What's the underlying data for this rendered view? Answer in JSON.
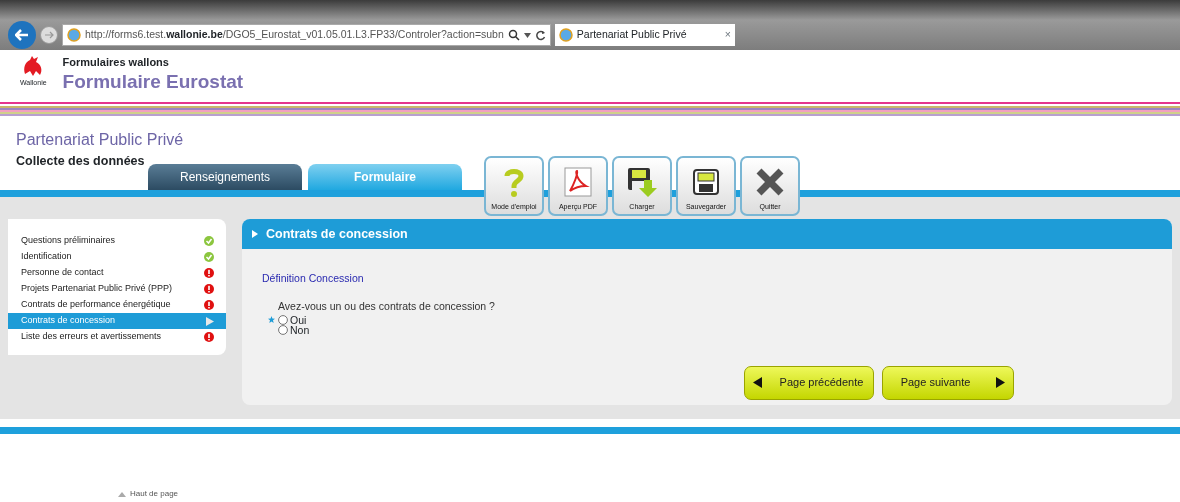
{
  "browser": {
    "url_prefix": "http://forms6.test.",
    "url_domain": "wallonie.be",
    "url_rest": "/DGO5_Eurostat_v01.05.01.L3.FP33/Controler?action=subn",
    "tab_title": "Partenariat Public Privé",
    "tab_close": "×"
  },
  "header": {
    "logo_caption": "Wallonie",
    "subtitle": "Formulaires wallons",
    "title": "Formulaire Eurostat"
  },
  "page": {
    "title": "Partenariat Public Privé",
    "subtitle": "Collecte des données"
  },
  "tabs": [
    {
      "label": "Renseignements",
      "selected": false
    },
    {
      "label": "Formulaire",
      "selected": true
    }
  ],
  "toolbar": [
    {
      "kind": "help",
      "label": "Mode d'emploi"
    },
    {
      "kind": "pdf",
      "label": "Aperçu PDF"
    },
    {
      "kind": "load",
      "label": "Charger"
    },
    {
      "kind": "save",
      "label": "Sauvegarder"
    },
    {
      "kind": "quit",
      "label": "Quitter"
    }
  ],
  "sidebar": {
    "items": [
      {
        "label": "Questions préliminaires",
        "kind": "ok",
        "selected": false
      },
      {
        "label": "Identification",
        "kind": "ok",
        "selected": false
      },
      {
        "label": "Personne de contact",
        "kind": "error",
        "selected": false
      },
      {
        "label": "Projets Partenariat Public Privé (PPP)",
        "kind": "error",
        "selected": false
      },
      {
        "label": "Contrats de performance énergétique",
        "kind": "error",
        "selected": false
      },
      {
        "label": "Contrats de concession",
        "kind": "current",
        "selected": true
      },
      {
        "label": "Liste des erreurs et avertissements",
        "kind": "error",
        "selected": false
      }
    ]
  },
  "section": {
    "title": "Contrats de concession",
    "link": "Définition Concession",
    "question": "Avez-vous un ou des contrats de concession ?",
    "required": true,
    "options": [
      {
        "label": "Oui",
        "checked": false
      },
      {
        "label": "Non",
        "checked": false
      }
    ]
  },
  "nav_buttons": [
    {
      "kind": "prev",
      "label": "Page précédente"
    },
    {
      "kind": "next",
      "label": "Page suivante"
    }
  ],
  "footer": {
    "link": "Haut de page"
  }
}
